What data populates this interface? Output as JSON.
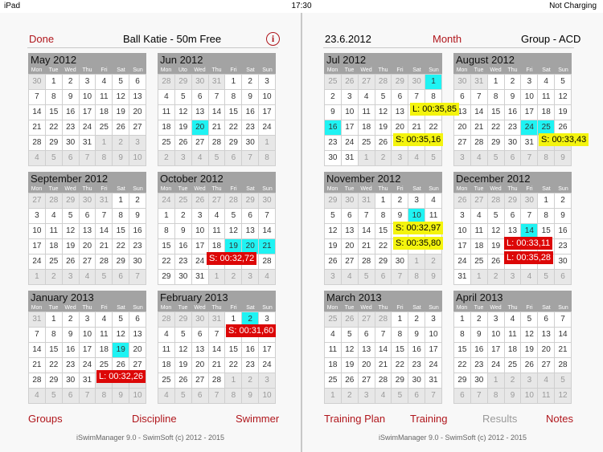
{
  "status": {
    "device": "iPad",
    "time": "17:30",
    "battery": "Not Charging"
  },
  "left": {
    "done": "Done",
    "title": "Ball Katie - 50m Free",
    "info": "i",
    "tabs": {
      "groups": "Groups",
      "discipline": "Discipline",
      "swimmer": "Swimmer"
    },
    "footer": "iSwimManager 9.0 - SwimSoft (c) 2012 - 2015"
  },
  "right": {
    "date": "23.6.2012",
    "view": "Month",
    "group": "Group - ACD",
    "tabs": {
      "plan": "Training Plan",
      "training": "Training",
      "results": "Results",
      "notes": "Notes"
    },
    "footer": "iSwimManager 9.0 - SwimSoft (c) 2012 - 2015"
  },
  "dows_en": [
    "Mon",
    "Tue",
    "Wed",
    "Thu",
    "Fri",
    "Sat",
    "Sun"
  ],
  "dows_jun": [
    "Mon",
    "Uto",
    "Wed",
    "Thu",
    "Fri",
    "Sat",
    "Sun"
  ],
  "months": [
    {
      "title": "May 2012",
      "dows": "en",
      "days": [
        "30",
        "1",
        "2",
        "3",
        "4",
        "5",
        "6",
        "7",
        "8",
        "9",
        "10",
        "11",
        "12",
        "13",
        "14",
        "15",
        "16",
        "17",
        "18",
        "19",
        "20",
        "21",
        "22",
        "23",
        "24",
        "25",
        "26",
        "27",
        "28",
        "29",
        "30",
        "31",
        "1",
        "2",
        "3",
        "4",
        "5",
        "6",
        "7",
        "8",
        "9",
        "10"
      ],
      "first": 1,
      "count": 31,
      "hl": []
    },
    {
      "title": "Jun 2012",
      "dows": "jun",
      "days": [
        "28",
        "29",
        "30",
        "31",
        "1",
        "2",
        "3",
        "4",
        "5",
        "6",
        "7",
        "8",
        "9",
        "10",
        "11",
        "12",
        "13",
        "14",
        "15",
        "16",
        "17",
        "18",
        "19",
        "20",
        "21",
        "22",
        "23",
        "24",
        "25",
        "26",
        "27",
        "28",
        "29",
        "30",
        "1",
        "2",
        "3",
        "4",
        "5",
        "6",
        "7",
        "8"
      ],
      "first": 4,
      "count": 30,
      "hl": [
        23
      ]
    },
    {
      "title": "Jul 2012",
      "dows": "en",
      "days": [
        "25",
        "26",
        "27",
        "28",
        "29",
        "30",
        "1",
        "2",
        "3",
        "4",
        "5",
        "6",
        "7",
        "8",
        "9",
        "10",
        "11",
        "12",
        "13",
        "14",
        "15",
        "16",
        "17",
        "18",
        "19",
        "20",
        "21",
        "22",
        "23",
        "24",
        "25",
        "26",
        "27",
        "28",
        "29",
        "30",
        "31",
        "1",
        "2",
        "3",
        "4",
        "5"
      ],
      "first": 6,
      "count": 31,
      "hl": [
        6,
        21
      ]
    },
    {
      "title": "August 2012",
      "dows": "en",
      "days": [
        "30",
        "31",
        "1",
        "2",
        "3",
        "4",
        "5",
        "6",
        "7",
        "8",
        "9",
        "10",
        "11",
        "12",
        "13",
        "14",
        "15",
        "16",
        "17",
        "18",
        "19",
        "20",
        "21",
        "22",
        "23",
        "24",
        "25",
        "26",
        "27",
        "28",
        "29",
        "30",
        "31",
        "1",
        "2",
        "3",
        "4",
        "5",
        "6",
        "7",
        "8",
        "9"
      ],
      "first": 2,
      "count": 31,
      "hl": [
        25,
        26
      ]
    },
    {
      "title": "September 2012",
      "dows": "en",
      "days": [
        "27",
        "28",
        "29",
        "30",
        "31",
        "1",
        "2",
        "3",
        "4",
        "5",
        "6",
        "7",
        "8",
        "9",
        "10",
        "11",
        "12",
        "13",
        "14",
        "15",
        "16",
        "17",
        "18",
        "19",
        "20",
        "21",
        "22",
        "23",
        "24",
        "25",
        "26",
        "27",
        "28",
        "29",
        "30",
        "1",
        "2",
        "3",
        "4",
        "5",
        "6",
        "7"
      ],
      "first": 5,
      "count": 30,
      "hl": []
    },
    {
      "title": "October 2012",
      "dows": "en",
      "days": [
        "24",
        "25",
        "26",
        "27",
        "28",
        "29",
        "30",
        "1",
        "2",
        "3",
        "4",
        "5",
        "6",
        "7",
        "8",
        "9",
        "10",
        "11",
        "12",
        "13",
        "14",
        "15",
        "16",
        "17",
        "18",
        "19",
        "20",
        "21",
        "22",
        "23",
        "24",
        "25",
        "26",
        "27",
        "28",
        "29",
        "30",
        "31",
        "1",
        "2",
        "3",
        "4"
      ],
      "first": 7,
      "count": 31,
      "hl": [
        25,
        26,
        27
      ]
    },
    {
      "title": "November 2012",
      "dows": "en",
      "days": [
        "29",
        "30",
        "31",
        "1",
        "2",
        "3",
        "4",
        "5",
        "6",
        "7",
        "8",
        "9",
        "10",
        "11",
        "12",
        "13",
        "14",
        "15",
        "16",
        "17",
        "18",
        "19",
        "20",
        "21",
        "22",
        "23",
        "24",
        "25",
        "26",
        "27",
        "28",
        "29",
        "30",
        "1",
        "2",
        "3",
        "4",
        "5",
        "6",
        "7",
        "8",
        "9"
      ],
      "first": 3,
      "count": 30,
      "hl": [
        12
      ]
    },
    {
      "title": "December 2012",
      "dows": "en",
      "days": [
        "26",
        "27",
        "28",
        "29",
        "30",
        "1",
        "2",
        "3",
        "4",
        "5",
        "6",
        "7",
        "8",
        "9",
        "10",
        "11",
        "12",
        "13",
        "14",
        "15",
        "16",
        "17",
        "18",
        "19",
        "20",
        "21",
        "22",
        "23",
        "24",
        "25",
        "26",
        "27",
        "28",
        "29",
        "30",
        "31",
        "1",
        "2",
        "3",
        "4",
        "5",
        "6"
      ],
      "first": 5,
      "count": 31,
      "hl": [
        18
      ]
    },
    {
      "title": "January 2013",
      "dows": "en",
      "days": [
        "31",
        "1",
        "2",
        "3",
        "4",
        "5",
        "6",
        "7",
        "8",
        "9",
        "10",
        "11",
        "12",
        "13",
        "14",
        "15",
        "16",
        "17",
        "18",
        "19",
        "20",
        "21",
        "22",
        "23",
        "24",
        "25",
        "26",
        "27",
        "28",
        "29",
        "30",
        "31",
        "1",
        "2",
        "3",
        "4",
        "5",
        "6",
        "7",
        "8",
        "9",
        "10"
      ],
      "first": 1,
      "count": 31,
      "hl": [
        19
      ]
    },
    {
      "title": "February 2013",
      "dows": "en",
      "days": [
        "28",
        "29",
        "30",
        "31",
        "1",
        "2",
        "3",
        "4",
        "5",
        "6",
        "7",
        "8",
        "9",
        "10",
        "11",
        "12",
        "13",
        "14",
        "15",
        "16",
        "17",
        "18",
        "19",
        "20",
        "21",
        "22",
        "23",
        "24",
        "25",
        "26",
        "27",
        "28",
        "1",
        "2",
        "3",
        "4",
        "5",
        "6",
        "7",
        "8",
        "9",
        "10"
      ],
      "first": 4,
      "count": 28,
      "hl": [
        5
      ]
    },
    {
      "title": "March 2013",
      "dows": "en",
      "days": [
        "25",
        "26",
        "27",
        "28",
        "1",
        "2",
        "3",
        "4",
        "5",
        "6",
        "7",
        "8",
        "9",
        "10",
        "11",
        "12",
        "13",
        "14",
        "15",
        "16",
        "17",
        "18",
        "19",
        "20",
        "21",
        "22",
        "23",
        "24",
        "25",
        "26",
        "27",
        "28",
        "29",
        "30",
        "31",
        "1",
        "2",
        "3",
        "4",
        "5",
        "6",
        "7"
      ],
      "first": 4,
      "count": 31,
      "hl": []
    },
    {
      "title": "April 2013",
      "dows": "en",
      "days": [
        "1",
        "2",
        "3",
        "4",
        "5",
        "6",
        "7",
        "8",
        "9",
        "10",
        "11",
        "12",
        "13",
        "14",
        "15",
        "16",
        "17",
        "18",
        "19",
        "20",
        "21",
        "22",
        "23",
        "24",
        "25",
        "26",
        "27",
        "28",
        "29",
        "30",
        "1",
        "2",
        "3",
        "4",
        "5",
        "6",
        "7",
        "8",
        "9",
        "10",
        "11",
        "12"
      ],
      "first": 0,
      "count": 30,
      "hl": []
    }
  ],
  "results": [
    {
      "text": "L: 00:35,85",
      "kind": "l2"
    },
    {
      "text": "S: 00:35,16",
      "kind": "s"
    },
    {
      "text": "S: 00:33,43",
      "kind": "s"
    },
    {
      "text": "S: 00:32,72",
      "kind": "l"
    },
    {
      "text": "S: 00:32,97",
      "kind": "s"
    },
    {
      "text": "S: 00:35,80",
      "kind": "s"
    },
    {
      "text": "L: 00:33,11",
      "kind": "l"
    },
    {
      "text": "L: 00:35,28",
      "kind": "l"
    },
    {
      "text": "S: 00:31,60",
      "kind": "l"
    },
    {
      "text": "L: 00:32,26",
      "kind": "l"
    }
  ],
  "colors": {
    "accent": "#b0161c",
    "highlight": "#1ff3f3",
    "short_course": "#f4f40e",
    "long_course": "#dc0707"
  }
}
